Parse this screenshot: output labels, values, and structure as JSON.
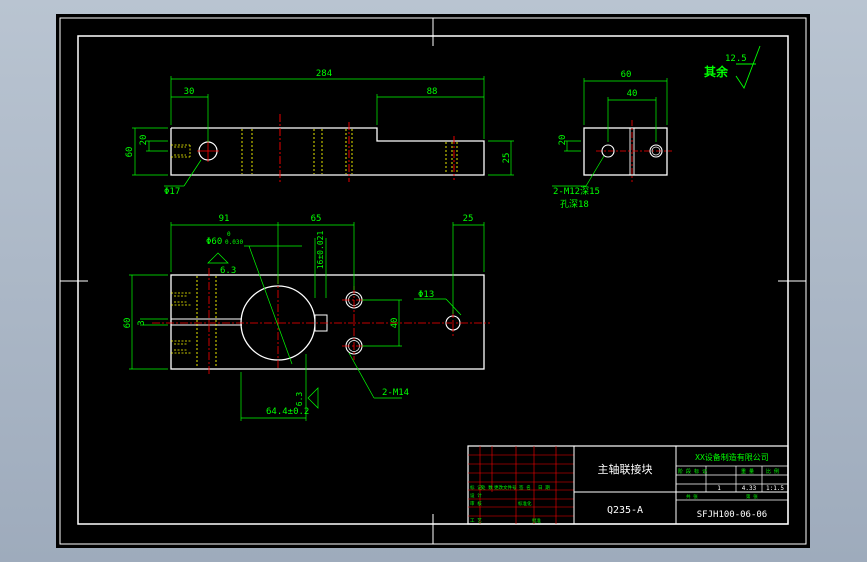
{
  "colors": {
    "background": "#000000",
    "frame": "#ffffff",
    "outline": "#ffffff",
    "dimension": "#00ff00",
    "centerline": "#ff0000",
    "hidden": "#ffff00",
    "hatch": "#00ffff",
    "titleblock_grid": "#ff0000"
  },
  "dimensions": {
    "overall_length": "284",
    "left_offset": "30",
    "slot_length": "88",
    "height_left": "60",
    "hole_height": "20",
    "right_step": "25",
    "hole_dia_top": "Φ17",
    "side_width": "60",
    "side_hole_spacing": "40",
    "side_hole_height": "20",
    "thread_callout_1": "2-M12深15",
    "thread_callout_2": "孔深18",
    "front_91": "91",
    "front_65": "65",
    "front_25": "25",
    "bore_dia": "Φ60",
    "bore_tol_upper": "0",
    "bore_tol_lower": "0.030",
    "bore_tol_combined": "Φ60-0.030",
    "rough_value_1": "6.3",
    "vertical_tol": "16±0.021",
    "hole_dia_front": "Φ13",
    "front_height": "60",
    "slit_width": "3",
    "hole_spacing_front": "40",
    "thread_callout_3": "2-M14",
    "bottom_dim": "64.4±0.2",
    "rough_value_2": "6.3"
  },
  "surface_finish": {
    "label": "其余",
    "value": "12.5"
  },
  "title_block": {
    "part_name": "主轴联接块",
    "material": "Q235-A",
    "company": "XX设备制造有限公司",
    "drawing_number": "SFJH100-06-06",
    "right_header_labels": [
      "阶 段 标 记",
      "重 量",
      "比 例"
    ],
    "quantity": "1",
    "weight": "4.33",
    "scale": "1:1.5",
    "sheet_labels": [
      "共  张",
      "第  张"
    ],
    "change_headers": [
      "标 记",
      "处 数",
      "更改文件号",
      "签 名",
      "日 期"
    ],
    "role_labels": [
      "设 计",
      "审 核",
      "工 艺"
    ],
    "standard_label": "标准化",
    "approve_label": "批准"
  }
}
